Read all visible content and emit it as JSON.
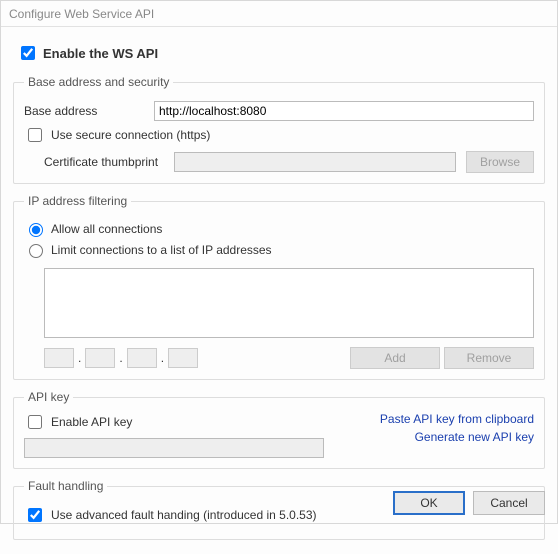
{
  "window": {
    "title": "Configure Web Service API"
  },
  "enable": {
    "label": "Enable the WS API",
    "checked": true
  },
  "base_security": {
    "legend": "Base address and security",
    "base_address_label": "Base address",
    "base_address_value": "http://localhost:8080",
    "use_https_label": "Use secure connection (https)",
    "use_https_checked": false,
    "cert_thumbprint_label": "Certificate thumbprint",
    "cert_thumbprint_value": "",
    "browse_label": "Browse"
  },
  "ip_filter": {
    "legend": "IP address filtering",
    "allow_all_label": "Allow all connections",
    "limit_label": "Limit connections to a list of IP addresses",
    "selected": "allow_all",
    "list_value": "",
    "add_label": "Add",
    "remove_label": "Remove"
  },
  "api_key": {
    "legend": "API key",
    "enable_label": "Enable API key",
    "enable_checked": false,
    "value": "",
    "paste_link": "Paste API key from clipboard",
    "generate_link": "Generate new API key"
  },
  "fault": {
    "legend": "Fault handling",
    "advanced_label": "Use advanced fault handing (introduced in 5.0.53)",
    "advanced_checked": true
  },
  "footer": {
    "ok": "OK",
    "cancel": "Cancel"
  }
}
